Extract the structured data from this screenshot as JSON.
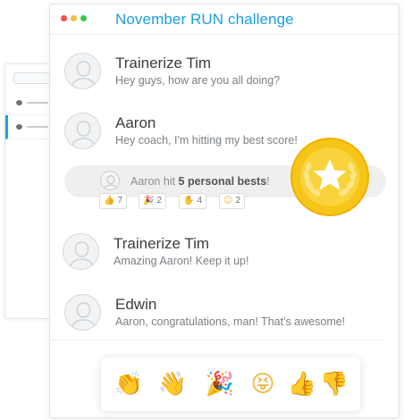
{
  "window": {
    "title": "November RUN challenge"
  },
  "messages": [
    {
      "sender": "Trainerize Tim",
      "text": "Hey guys, how are you all doing?"
    },
    {
      "sender": "Aaron",
      "text": "Hey coach, I'm hitting my best score!"
    },
    {
      "sender": "Trainerize Tim",
      "text": "Amazing Aaron! Keep it up!"
    },
    {
      "sender": "Edwin",
      "text": "Aaron, congratulations, man! That's awesome!"
    }
  ],
  "achievement": {
    "prefix": "Aaron hit ",
    "highlight": "5 personal bests",
    "suffix": "!",
    "reactions": [
      {
        "icon": "thumbs-up-icon",
        "count": "7"
      },
      {
        "icon": "party-popper-icon",
        "count": "2"
      },
      {
        "icon": "waving-hand-icon",
        "count": "4"
      },
      {
        "icon": "medal-face-icon",
        "count": "2"
      }
    ]
  },
  "emoji_bar": [
    "clapping-hands-icon",
    "waving-hand-icon",
    "party-popper-icon",
    "tongue-face-icon",
    "thumbs-up-icon",
    "thumbs-down-icon"
  ],
  "colors": {
    "accent": "#1a9fe0",
    "medal": "#f5c518",
    "selected": "#1aa3e8"
  }
}
